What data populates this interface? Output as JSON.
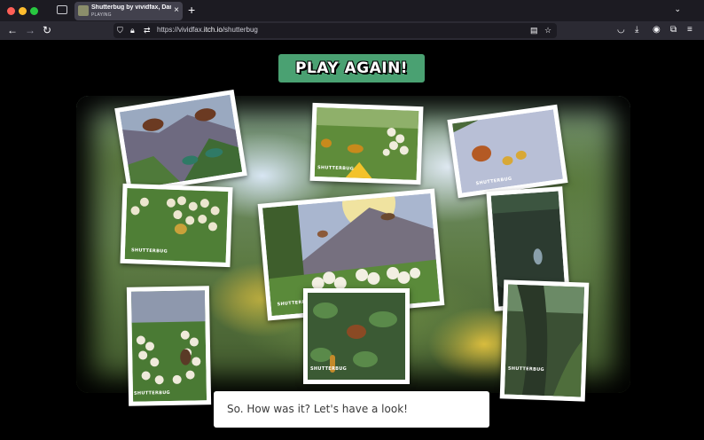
{
  "browser": {
    "tab_title": "Shutterbug by vividfax, Dan Ems",
    "tab_status": "PLAYING",
    "url_prefix": "https://vividfax.",
    "url_domain": "itch.io",
    "url_path": "/shutterbug",
    "new_tab_label": "+",
    "close_label": "×"
  },
  "game": {
    "play_again_label": "PLAY AGAIN!",
    "watermark": "SHUTTERBUG",
    "dialog_text": "So. How was it? Let's have a look!",
    "photos": [
      {
        "id": "photo-butterflies-mountain",
        "subject": "butterflies over mountain"
      },
      {
        "id": "photo-hoverfly-flowers",
        "subject": "hoverfly on white flowers"
      },
      {
        "id": "photo-butterfly-bees-sky",
        "subject": "butterfly and bees in sky"
      },
      {
        "id": "photo-bee-flowers",
        "subject": "bee on white flowers"
      },
      {
        "id": "photo-meadow-mountain",
        "subject": "meadow with mountain"
      },
      {
        "id": "photo-dark-forest-bug",
        "subject": "bug in dark forest"
      },
      {
        "id": "photo-flower-stalk",
        "subject": "white flower stalk"
      },
      {
        "id": "photo-caterpillar-leaves",
        "subject": "butterfly and caterpillar in leaves"
      },
      {
        "id": "photo-forest-trunk",
        "subject": "forest tree trunk"
      }
    ]
  },
  "colors": {
    "play_again_bg": "#4aa172",
    "photo_border": "#ffffff",
    "chrome_bg": "#1c1b22"
  },
  "icons": [
    "tab-manager-icon",
    "back-arrow-icon",
    "forward-arrow-icon",
    "reload-icon",
    "shield-icon",
    "lock-icon",
    "permissions-icon",
    "reader-view-icon",
    "star-icon",
    "pocket-icon",
    "download-icon",
    "account-icon",
    "extensions-icon",
    "menu-icon",
    "chevron-down-icon"
  ]
}
